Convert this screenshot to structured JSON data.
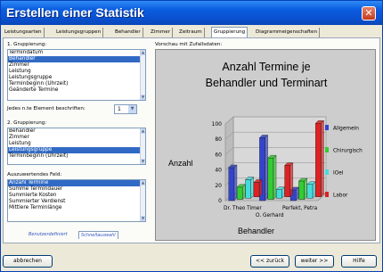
{
  "window": {
    "title": "Erstellen einer Statistik",
    "close_symbol": "✕"
  },
  "tabs": [
    {
      "label": "Leistungsarten",
      "active": false
    },
    {
      "label": "Leistungsgruppen",
      "active": false
    },
    {
      "label": "Behandler",
      "active": false
    },
    {
      "label": "Zimmer",
      "active": false
    },
    {
      "label": "Zeitraum",
      "active": false
    },
    {
      "label": "Gruppierung",
      "active": true
    },
    {
      "label": "Diagrammeigenschaften",
      "active": false
    }
  ],
  "grouping1": {
    "label": "1. Gruppierung:",
    "items": [
      "Termindatum",
      "Behandler",
      "Zimmer",
      "Leistung",
      "Leistungsgruppe",
      "Terminbeginn (Uhrzeit)",
      "Geänderte Termine"
    ],
    "selected_index": 1
  },
  "nth_element": {
    "label": "Jedes n.te Element beschriften:",
    "value": "1"
  },
  "grouping2": {
    "label": "2. Gruppierung:",
    "items": [
      "Behandler",
      "Zimmer",
      "Leistung",
      "Leistungsgruppe",
      "Terminbeginn (Uhrzeit)"
    ],
    "selected_index": 3
  },
  "evaluated_field": {
    "label": "Auszuwertendes Feld:",
    "items": [
      "Anzahl Termine",
      "Summe Termindauer",
      "Summierte Kosten",
      "Summierter Verdienst",
      "Mittlere Terminlänge"
    ],
    "selected_index": 0
  },
  "mode_tabs": [
    {
      "label": "Benutzerdefiniert",
      "active": false
    },
    {
      "label": "Schnellauswahl",
      "active": true
    }
  ],
  "preview_label": "Vorschau mit Zufallsdaten:",
  "chart_data": {
    "type": "bar",
    "title": "Anzahl Termine je Behandler und Terminart",
    "title_lines": [
      "Anzahl Termine je",
      "Behandler und Terminart"
    ],
    "ylabel": "Anzahl",
    "xlabel": "Behandler",
    "ylim": [
      0,
      100
    ],
    "yticks": [
      0,
      20,
      40,
      60,
      80,
      100
    ],
    "grid": true,
    "legend_position": "right",
    "categories": [
      "Dr. Theo Timer",
      "Perfekt, Petra",
      "Gerhard"
    ],
    "category_label_lines": [
      [
        "Dr. Theo Timer"
      ],
      [
        "Perfekt, Petra"
      ],
      [
        "O. Gerhard"
      ]
    ],
    "series": [
      {
        "name": "Allgemein",
        "color": "#3344cc",
        "values": [
          43,
          82,
          14
        ]
      },
      {
        "name": "Chirurgisch",
        "color": "#33cc33",
        "values": [
          16,
          54,
          24
        ]
      },
      {
        "name": "IOel",
        "color": "#44dddd",
        "values": [
          24,
          11,
          18
        ]
      },
      {
        "name": "Labor",
        "color": "#dd2222",
        "values": [
          19,
          41,
          96
        ]
      }
    ]
  },
  "buttons": {
    "cancel": "abbrechen",
    "back": "<< zurück",
    "next": "weiter >>",
    "help": "Hilfe"
  }
}
